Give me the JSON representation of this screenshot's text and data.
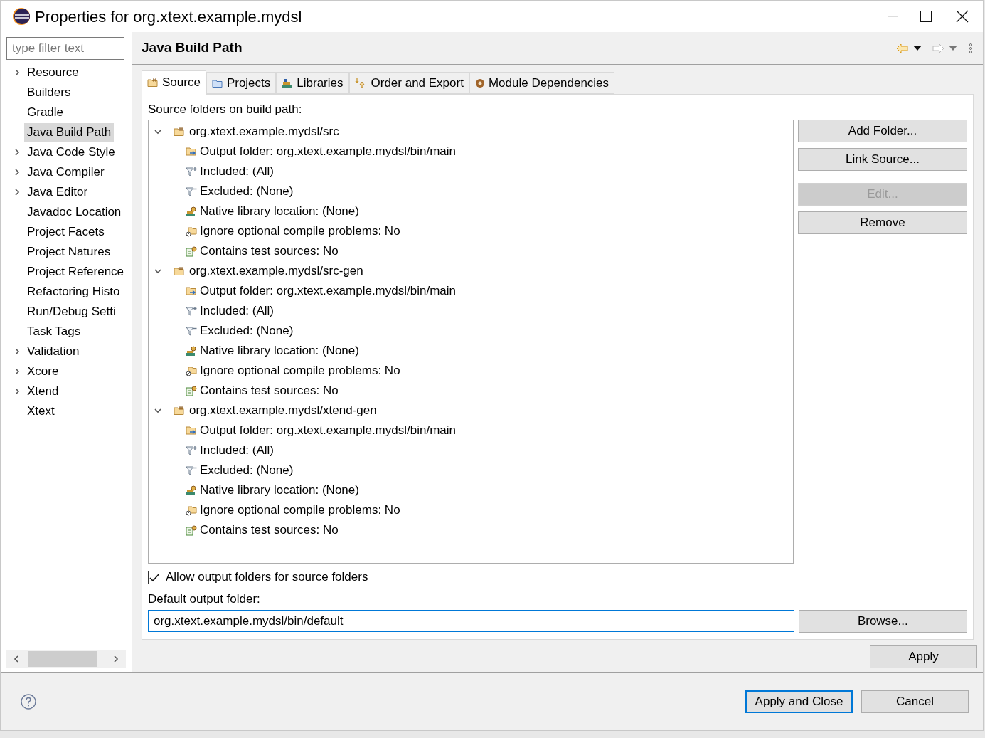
{
  "window": {
    "title": "Properties for org.xtext.example.mydsl"
  },
  "filter": {
    "placeholder": "type filter text"
  },
  "sidebar": {
    "items": [
      {
        "label": "Resource",
        "expandable": true,
        "selected": false
      },
      {
        "label": "Builders",
        "expandable": false,
        "selected": false
      },
      {
        "label": "Gradle",
        "expandable": false,
        "selected": false
      },
      {
        "label": "Java Build Path",
        "expandable": false,
        "selected": true
      },
      {
        "label": "Java Code Style",
        "expandable": true,
        "selected": false
      },
      {
        "label": "Java Compiler",
        "expandable": true,
        "selected": false
      },
      {
        "label": "Java Editor",
        "expandable": true,
        "selected": false
      },
      {
        "label": "Javadoc Location",
        "expandable": false,
        "selected": false
      },
      {
        "label": "Project Facets",
        "expandable": false,
        "selected": false
      },
      {
        "label": "Project Natures",
        "expandable": false,
        "selected": false
      },
      {
        "label": "Project Reference",
        "expandable": false,
        "selected": false
      },
      {
        "label": "Refactoring Histo",
        "expandable": false,
        "selected": false
      },
      {
        "label": "Run/Debug Setti",
        "expandable": false,
        "selected": false
      },
      {
        "label": "Task Tags",
        "expandable": false,
        "selected": false
      },
      {
        "label": "Validation",
        "expandable": true,
        "selected": false
      },
      {
        "label": "Xcore",
        "expandable": true,
        "selected": false
      },
      {
        "label": "Xtend",
        "expandable": true,
        "selected": false
      },
      {
        "label": "Xtext",
        "expandable": false,
        "selected": false
      }
    ]
  },
  "page_title": "Java Build Path",
  "tabs": [
    {
      "label": "Source",
      "kind": "source",
      "selected": true
    },
    {
      "label": "Projects",
      "kind": "projects",
      "selected": false
    },
    {
      "label": "Libraries",
      "kind": "libraries",
      "selected": false
    },
    {
      "label": "Order and Export",
      "kind": "order",
      "selected": false
    },
    {
      "label": "Module Dependencies",
      "kind": "module",
      "selected": false
    }
  ],
  "source_label": "Source folders on build path:",
  "tree": [
    {
      "label": "org.xtext.example.mydsl/src",
      "expanded": true,
      "children": [
        {
          "kind": "output",
          "label": "Output folder: org.xtext.example.mydsl/bin/main"
        },
        {
          "kind": "included",
          "label": "Included: (All)"
        },
        {
          "kind": "excluded",
          "label": "Excluded: (None)"
        },
        {
          "kind": "native",
          "label": "Native library location: (None)"
        },
        {
          "kind": "ignore",
          "label": "Ignore optional compile problems: No"
        },
        {
          "kind": "test",
          "label": "Contains test sources: No"
        }
      ]
    },
    {
      "label": "org.xtext.example.mydsl/src-gen",
      "expanded": true,
      "children": [
        {
          "kind": "output",
          "label": "Output folder: org.xtext.example.mydsl/bin/main"
        },
        {
          "kind": "included",
          "label": "Included: (All)"
        },
        {
          "kind": "excluded",
          "label": "Excluded: (None)"
        },
        {
          "kind": "native",
          "label": "Native library location: (None)"
        },
        {
          "kind": "ignore",
          "label": "Ignore optional compile problems: No"
        },
        {
          "kind": "test",
          "label": "Contains test sources: No"
        }
      ]
    },
    {
      "label": "org.xtext.example.mydsl/xtend-gen",
      "expanded": true,
      "children": [
        {
          "kind": "output",
          "label": "Output folder: org.xtext.example.mydsl/bin/main"
        },
        {
          "kind": "included",
          "label": "Included: (All)"
        },
        {
          "kind": "excluded",
          "label": "Excluded: (None)"
        },
        {
          "kind": "native",
          "label": "Native library location: (None)"
        },
        {
          "kind": "ignore",
          "label": "Ignore optional compile problems: No"
        },
        {
          "kind": "test",
          "label": "Contains test sources: No"
        }
      ]
    }
  ],
  "side_buttons": [
    {
      "label": "Add Folder...",
      "disabled": false
    },
    {
      "label": "Link Source...",
      "disabled": false
    },
    {
      "label": "Edit...",
      "disabled": true
    },
    {
      "label": "Remove",
      "disabled": false
    }
  ],
  "allow_output": {
    "label": "Allow output folders for source folders",
    "checked": true
  },
  "default_output": {
    "label": "Default output folder:",
    "value": "org.xtext.example.mydsl/bin/default"
  },
  "browse_button": "Browse...",
  "apply_button": "Apply",
  "footer_buttons": [
    {
      "label": "Apply and Close",
      "default": true
    },
    {
      "label": "Cancel",
      "default": false
    }
  ]
}
